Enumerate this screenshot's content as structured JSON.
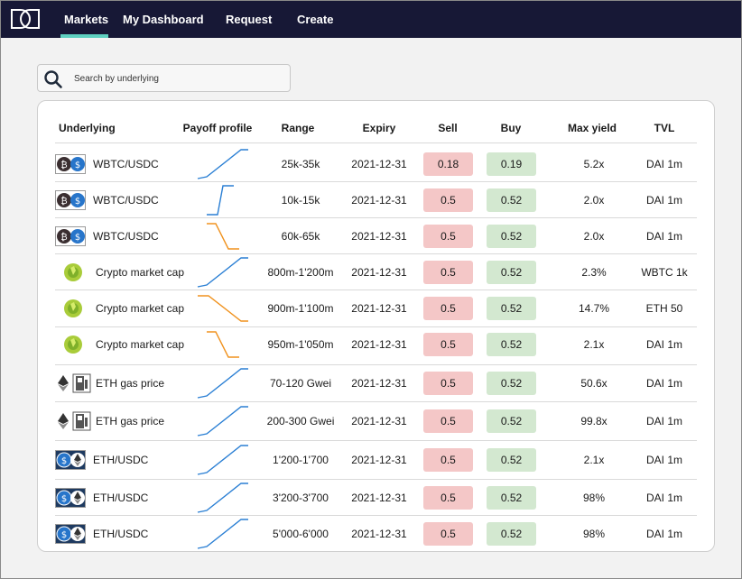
{
  "nav": {
    "items": [
      {
        "label": "Markets"
      },
      {
        "label": "My Dashboard"
      },
      {
        "label": "Request"
      },
      {
        "label": "Create"
      }
    ],
    "active": "Markets",
    "accent_color": "#5ed0c0",
    "bg_color": "#171836"
  },
  "search": {
    "placeholder": "Search by underlying",
    "value": ""
  },
  "table": {
    "headers": {
      "underlying": "Underlying",
      "payoff": "Payoff profile",
      "range": "Range",
      "expiry": "Expiry",
      "sell": "Sell",
      "buy": "Buy",
      "max_yield": "Max yield",
      "tvl": "TVL"
    },
    "rows": [
      {
        "underlying": "WBTC/USDC",
        "icon": "wbtc-usdc-icon",
        "payoff": "up",
        "range": "25k-35k",
        "expiry": "2021-12-31",
        "sell": "0.18",
        "buy": "0.19",
        "max_yield": "5.2x",
        "tvl": "DAI 1m"
      },
      {
        "underlying": "WBTC/USDC",
        "icon": "wbtc-usdc-icon",
        "payoff": "up-steep",
        "range": "10k-15k",
        "expiry": "2021-12-31",
        "sell": "0.5",
        "buy": "0.52",
        "max_yield": "2.0x",
        "tvl": "DAI 1m"
      },
      {
        "underlying": "WBTC/USDC",
        "icon": "wbtc-usdc-icon",
        "payoff": "down-steep",
        "range": "60k-65k",
        "expiry": "2021-12-31",
        "sell": "0.5",
        "buy": "0.52",
        "max_yield": "2.0x",
        "tvl": "DAI 1m"
      },
      {
        "underlying": "Crypto market cap",
        "icon": "market-cap-icon",
        "payoff": "up",
        "range": "800m-1'200m",
        "expiry": "2021-12-31",
        "sell": "0.5",
        "buy": "0.52",
        "max_yield": "2.3%",
        "tvl": "WBTC 1k"
      },
      {
        "underlying": "Crypto market cap",
        "icon": "market-cap-icon",
        "payoff": "down",
        "range": "900m-1'100m",
        "expiry": "2021-12-31",
        "sell": "0.5",
        "buy": "0.52",
        "max_yield": "14.7%",
        "tvl": "ETH 50"
      },
      {
        "underlying": "Crypto market cap",
        "icon": "market-cap-icon",
        "payoff": "down-steep",
        "range": "950m-1'050m",
        "expiry": "2021-12-31",
        "sell": "0.5",
        "buy": "0.52",
        "max_yield": "2.1x",
        "tvl": "DAI 1m"
      },
      {
        "underlying": "ETH gas price",
        "icon": "eth-gas-icon",
        "payoff": "up",
        "range": "70-120 Gwei",
        "expiry": "2021-12-31",
        "sell": "0.5",
        "buy": "0.52",
        "max_yield": "50.6x",
        "tvl": "DAI 1m"
      },
      {
        "underlying": "ETH gas price",
        "icon": "eth-gas-icon",
        "payoff": "up",
        "range": "200-300 Gwei",
        "expiry": "2021-12-31",
        "sell": "0.5",
        "buy": "0.52",
        "max_yield": "99.8x",
        "tvl": "DAI 1m"
      },
      {
        "underlying": "ETH/USDC",
        "icon": "eth-usdc-icon",
        "payoff": "up",
        "range": "1'200-1'700",
        "expiry": "2021-12-31",
        "sell": "0.5",
        "buy": "0.52",
        "max_yield": "2.1x",
        "tvl": "DAI 1m"
      },
      {
        "underlying": "ETH/USDC",
        "icon": "eth-usdc-icon",
        "payoff": "up",
        "range": "3'200-3'700",
        "expiry": "2021-12-31",
        "sell": "0.5",
        "buy": "0.52",
        "max_yield": "98%",
        "tvl": "DAI 1m"
      },
      {
        "underlying": "ETH/USDC",
        "icon": "eth-usdc-icon",
        "payoff": "up",
        "range": "5'000-6'000",
        "expiry": "2021-12-31",
        "sell": "0.5",
        "buy": "0.52",
        "max_yield": "98%",
        "tvl": "DAI 1m"
      }
    ]
  },
  "colors": {
    "sell_bg": "#f4c7c7",
    "buy_bg": "#d3e8d0",
    "payoff_up": "#2a7fd4",
    "payoff_down": "#f0921e"
  }
}
